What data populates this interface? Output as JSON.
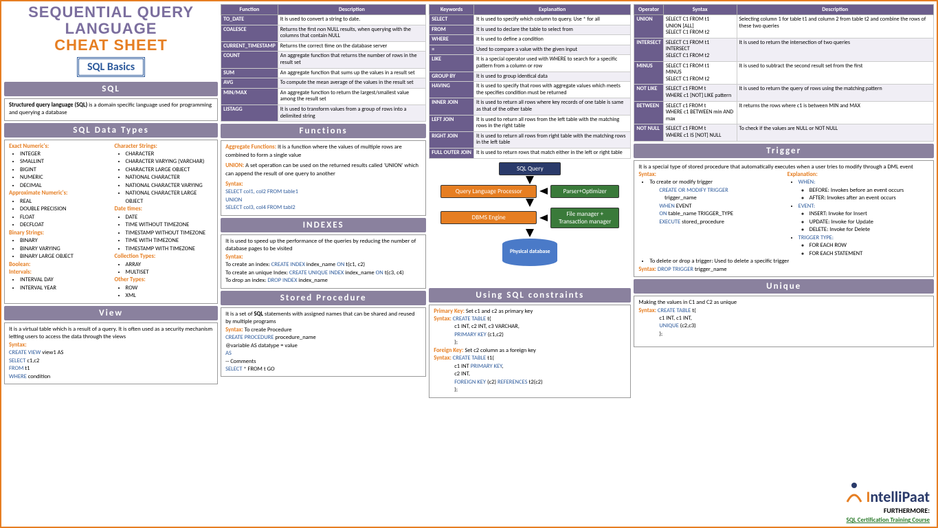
{
  "title": {
    "l1": "SEQUENTIAL QUERY",
    "l2": "LANGUAGE",
    "l3": "CHEAT SHEET",
    "badge": "SQL Basics"
  },
  "sql": {
    "hdr": "SQL",
    "body": "Structured query language (SQL) is a domain specific language used for programming and querying a database"
  },
  "datatypes": {
    "hdr": "SQL Data Types",
    "h_exact": "Exact Numeric's:",
    "exact": [
      "INTEGER",
      "SMALLINT",
      "BIGINT",
      "NUMERIC",
      "DECIMAL"
    ],
    "h_approx": "Approximate Numeric's:",
    "approx": [
      "REAL",
      "DOUBLE PRECISION",
      "FLOAT",
      "DECFLOAT"
    ],
    "h_bin": "Binary Strings:",
    "bin": [
      "BINARY",
      "BINARY VARYING",
      "BINARY LARGE OBJECT"
    ],
    "h_bool": "Boolean:",
    "h_int": "Intervals:",
    "intv": [
      "INTERVAL DAY",
      "INTERVAL YEAR"
    ],
    "h_char": "Character Strings:",
    "chars": [
      "CHARACTER",
      "CHARACTER VARYING (VARCHAR)",
      "CHARACTER LARGE OBJECT",
      "NATIONAL CHARACTER",
      "NATIONAL CHARACTER VARYING",
      "NATIONAL CHARACTER LARGE OBJECT"
    ],
    "h_dt": "Date times:",
    "dts": [
      "DATE",
      "TIME WITHOUT TIMEZONE",
      "TIMESTAMP WITHOUT TIMEZONE",
      "TIME WITH TIMEZONE",
      "TIMESTAMP WITH TIMEZONE"
    ],
    "h_coll": "Collection Types:",
    "coll": [
      "ARRAY",
      "MULTISET"
    ],
    "h_oth": "Other Types:",
    "oth": [
      "ROW",
      "XML"
    ]
  },
  "view": {
    "hdr": "View",
    "body": "It is a virtual table which is a result of a query. It is often used as a security mechanism letting users to access the data through the views",
    "syn_lbl": "Syntax:",
    "l1": "CREATE VIEW view1 AS",
    "l2": "SELECT c1,c2",
    "l3": "FROM t1",
    "l4": "WHERE condition"
  },
  "func_tbl": {
    "h1": "Function",
    "h2": "Description",
    "rows": [
      [
        "TO_DATE",
        "It is used to convert a string to date."
      ],
      [
        "COALESCE",
        "Returns the first non NULL results, when querying with the columns that contain NULL"
      ],
      [
        "CURRENT_TIMESTAMP",
        "Returns the correct time on the database server"
      ],
      [
        "COUNT",
        "An aggregate function that returns the number of rows in the result set"
      ],
      [
        "SUM",
        "An aggregate function that sums up the values in a result set"
      ],
      [
        "AVG",
        "To compute the mean average of the values in the result set"
      ],
      [
        "MIN/MAX",
        "An aggregate function to return the largest/smallest value among the result set"
      ],
      [
        "LISTAGG",
        "It is used to transform values from a group of rows into a delimited string"
      ]
    ]
  },
  "functions": {
    "hdr": "Functions",
    "agg_lbl": "Aggregate Functions:",
    "agg": " It is a function where the values of multiple rows are combined to form a single value",
    "union_lbl": "UNION:",
    "union": " A set operation can be used on the returned results called 'UNION' which can append the result of one query to another",
    "syn_lbl": "Syntax:",
    "l1": "SELECT col1, col2 FROM table1",
    "l2": "UNION",
    "l3": "SELECT col3, col4 FROM tabl2"
  },
  "indexes": {
    "hdr": "INDEXES",
    "body": "It is used to speed up the performance of the queries by reducing the number of database pages to be visited",
    "syn_lbl": "Syntax:",
    "l1a": "To create an index: ",
    "l1b": "CREATE INDEX",
    "l1c": " index_name ",
    "l1d": "ON",
    "l1e": " t(c1, c2)",
    "l2a": "To create an unique Index: ",
    "l2b": "CREATE UNIQUE INDEX",
    "l2c": " index_name ",
    "l2d": "ON",
    "l2e": " t(c3, c4)",
    "l3a": "To drop an index: ",
    "l3b": "DROP INDEX",
    "l3c": " index_name"
  },
  "sproc": {
    "hdr": "Stored Procedure",
    "body": "It is a set of SQL statements with assigned names that can be shared and reused by multiple programs",
    "syn_lbl": "Syntax:",
    "syn_txt": " To create Procedure",
    "l1": "CREATE PROCEDURE procedure_name",
    "l2": "@variable AS datatype = value",
    "l3": "AS",
    "l4": "-- Comments",
    "l5": "SELECT * FROM t GO"
  },
  "kw_tbl": {
    "h1": "Keywords",
    "h2": "Explanation",
    "rows": [
      [
        "SELECT",
        "It is used to specify which column to query. Use * for all"
      ],
      [
        "FROM",
        "It is used to declare the table to select from"
      ],
      [
        "WHERE",
        "It is used to define a condition"
      ],
      [
        "=",
        "Used to compare a value with the given input"
      ],
      [
        "LIKE",
        "It is a special operator used with WHERE to search for a specific pattern from a column or row"
      ],
      [
        "GROUP BY",
        "It is used to group identical data"
      ],
      [
        "HAVING",
        "It is used to specify that rows with aggregate values which meets the specifies condition must be returned"
      ],
      [
        "INNER JOIN",
        "It is used to return all rows where key records of one table is same as that of the other table"
      ],
      [
        "LEFT JOIN",
        "It is used to return all rows from the left table with the matching rows in the right table"
      ],
      [
        "RIGHT JOIN",
        "It is used to return all rows from right table with the matching rows in the left table"
      ],
      [
        "FULL OUTER JOIN",
        "It is used to return rows that match either in the left or right table"
      ]
    ]
  },
  "diagram": {
    "n1": "SQL Query",
    "n2": "Query Language Processor",
    "n2b": "Parser+Optimizer",
    "n3": "DBMS Engine",
    "n3b": "File manager + Transaction manager",
    "n4": "Physical database"
  },
  "constraints": {
    "hdr": "Using SQL constraints",
    "pk_lbl": "Primary Key:",
    "pk": " Set c1 and c2 as primary key",
    "syn_lbl": "Syntax: ",
    "ct": "CREATE TABLE ",
    "t1": "t(",
    "r1": "c1 INT, c2 INT, c3 VARCHAR,",
    "r2": "PRIMARY KEY (c1,c2)",
    "r3": ");",
    "fk_lbl": "Foreign Key:",
    "fk": " Set c2 column as a foreign key",
    "t2": "t1(",
    "r4a": "c1 INT ",
    "r4b": "PRIMARY KEY",
    "r4c": ",",
    "r5": "c2 INT,",
    "r6a": "FOREIGN KEY ",
    "r6b": "(c2) ",
    "r6c": "REFERENCES ",
    "r6d": "t2(c2)",
    "r7": ");"
  },
  "op_tbl": {
    "h1": "Operator",
    "h2": "Syntax",
    "h3": "Description",
    "rows": [
      [
        "UNION",
        "SELECT C1 FROM t1<br>UNION [ALL]<br>SELECT C1 FROM t2",
        "Selecting column 1 for table t1 and column 2 from table t2 and combine the rows of these two queries"
      ],
      [
        "INTERSECT",
        "SELECT C1 FROM t1<br>INTERSECT<br>SELECT C1 FROM t2",
        "It is used to return the intersection of two queries"
      ],
      [
        "MINUS",
        "SELECT C1 FROM t1<br>MINUS<br>SELECT C1 FROM t2",
        "It is used to subtract the second result set from the first"
      ],
      [
        "NOT LIKE",
        "SELECT c1 FROM t<br>WHERE c1 [NOT] LIKE pattern",
        "It is used to return the query of rows using the matching pattern"
      ],
      [
        "BETWEEN",
        "SELECT c1 FROM t<br>WHERE c1 BETWEEN min AND max",
        "It returns the rows where c1 is between MIN and MAX"
      ],
      [
        "NOT NULL",
        "SELECT c1 FROM t<br>WHERE c1 IS [NOT] NULL",
        "To check if the values are NULL or NOT NULL"
      ]
    ]
  },
  "trigger": {
    "hdr": "Trigger",
    "body": "It is a special type of stored procedure that automatically executes when a user tries to modify through a DML event",
    "syn_lbl": "Syntax:",
    "b1": "To create or modify trigger",
    "l1": "CREATE OR MODIFY TRIGGER trigger_name",
    "l2a": "WHEN",
    "l2b": " EVENT",
    "l3a": "ON",
    "l3b": " table_name TRIGGER_TYPE",
    "l4a": "EXECUTE",
    "l4b": " stored_procedure",
    "exp_lbl": "Explanation:",
    "e_when": "WHEN:",
    "e_w1": "BEFORE: Invokes before an event occurs",
    "e_w2": "AFTER: Invokes after an event occurs",
    "e_event": "EVENT:",
    "e_e1": "INSERT: Invoke for Insert",
    "e_e2": "UPDATE: Invoke for Update",
    "e_e3": "DELETE: Invoke for Delete",
    "e_tt": "TRIGGER TYPE:",
    "e_t1": "FOR EACH ROW",
    "e_t2": "FOR EACH STATEMENT",
    "b2": "To delete or drop a trigger: Used to delete a specific trigger",
    "drop_lbl": "Syntax: ",
    "drop": "DROP TRIGGER trigger_name"
  },
  "unique": {
    "hdr": "Unique",
    "body": "Making the values in C1 and C2 as unique",
    "syn_lbl": "Syntax: ",
    "ct": "CREATE TABLE ",
    "t": "t(",
    "r1": "c1 INT, c1 INT,",
    "r2": "UNIQUE (c2,c3)",
    "r3": ");"
  },
  "logo": {
    "brand_i": "I",
    "brand_rest": "ntelliPaat",
    "further": "FURTHERMORE:",
    "link": "SQL Certification Training Course"
  }
}
